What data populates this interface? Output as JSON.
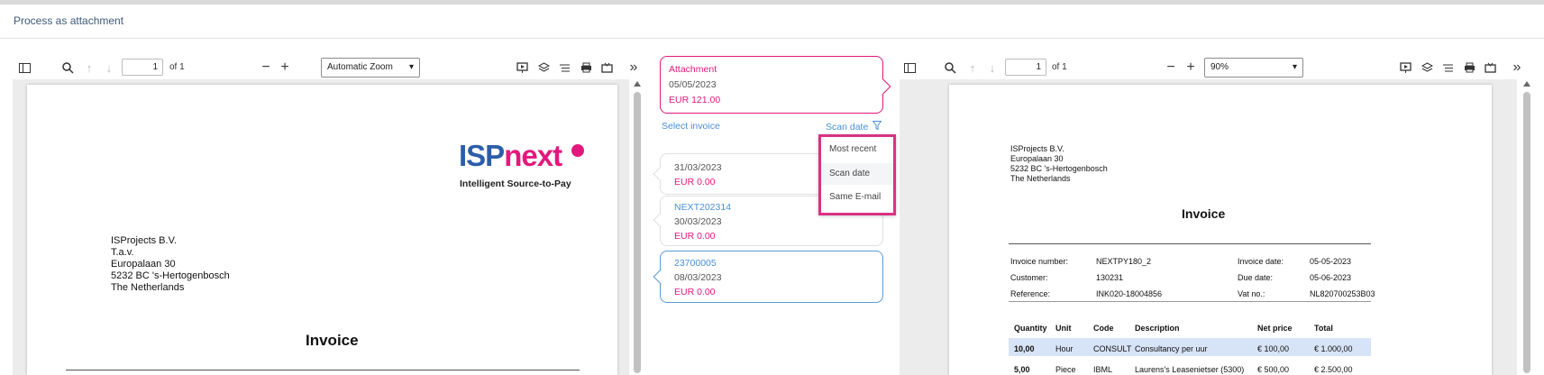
{
  "window": {
    "title": "Process as attachment"
  },
  "left_viewer": {
    "page": "1",
    "of_pages": "of 1",
    "zoom": "Automatic Zoom",
    "document": {
      "logo_isp": "ISP",
      "logo_next": "next",
      "tagline": "Intelligent Source-to-Pay",
      "address": [
        "ISProjects B.V.",
        "T.a.v.",
        "Europalaan 30",
        "5232 BC  's-Hertogenbosch",
        "The Netherlands"
      ],
      "title": "Invoice"
    }
  },
  "matching_panel": {
    "attachment": {
      "label": "Attachment",
      "date": "05/05/2023",
      "amount": "EUR 121.00"
    },
    "select_invoice": "Select invoice",
    "sort_label": "Scan date",
    "sort_options": [
      "Most recent",
      "Scan date",
      "Same E-mail"
    ],
    "invoices": [
      {
        "ref": "",
        "date": "31/03/2023",
        "amount": "EUR 0.00"
      },
      {
        "ref": "NEXT202314",
        "date": "30/03/2023",
        "amount": "EUR 0.00"
      },
      {
        "ref": "23700005",
        "date": "08/03/2023",
        "amount": "EUR 0.00"
      }
    ]
  },
  "right_viewer": {
    "page": "1",
    "of_pages": "of 1",
    "zoom": "90%",
    "document": {
      "address": [
        "ISProjects B.V.",
        "Europalaan 30",
        "5232 BC 's-Hertogenbosch",
        "The Netherlands"
      ],
      "title": "Invoice",
      "meta": {
        "invoice_number_label": "Invoice number:",
        "invoice_number": "NEXTPY180_2",
        "customer_label": "Customer:",
        "customer": "130231",
        "reference_label": "Reference:",
        "reference": "INK020-18004856",
        "invoice_date_label": "Invoice date:",
        "invoice_date": "05-05-2023",
        "due_date_label": "Due date:",
        "due_date": "05-06-2023",
        "vat_label": "Vat no.:",
        "vat": "NL820700253B03"
      },
      "table_headers": [
        "Quantity",
        "Unit",
        "Code",
        "Description",
        "Net price",
        "Total"
      ],
      "rows": [
        [
          "10,00",
          "Hour",
          "CONSULT",
          "Consultancy per uur",
          "€ 100,00",
          "€ 1.000,00"
        ],
        [
          "5,00",
          "Piece",
          "IBML",
          "Laurens's Leasenietser (5300)",
          "€ 500,00",
          "€ 2.500,00"
        ]
      ]
    }
  },
  "colors": {
    "accent_pink": "#e3187d",
    "accent_blue": "#4a90d9",
    "brand_blue": "#2c5ea8",
    "highlight": "#d63384"
  }
}
